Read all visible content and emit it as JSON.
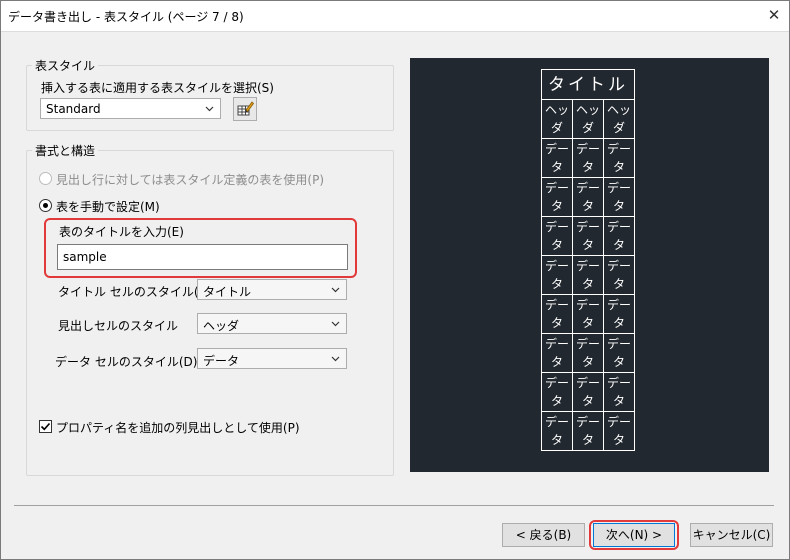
{
  "window": {
    "title": "データ書き出し - 表スタイル (ページ 7 / 8)",
    "close_glyph": "✕"
  },
  "table_style": {
    "group_label": "表スタイル",
    "select_label": "挿入する表に適用する表スタイルを選択(S)",
    "selected": "Standard"
  },
  "format": {
    "group_label": "書式と構造",
    "radio_style_label": "見出し行に対しては表スタイル定義の表を使用(P)",
    "radio_manual_label": "表を手動で設定(M)",
    "title_input_label": "表のタイトルを入力(E)",
    "title_input_value": "sample",
    "title_cell_label": "タイトル セルのスタイル(T)",
    "title_cell_value": "タイトル",
    "header_cell_label": "見出しセルのスタイル",
    "header_cell_value": "ヘッダ",
    "data_cell_label": "データ セルのスタイル(D)",
    "data_cell_value": "データ",
    "property_checkbox_label": "プロパティ名を追加の列見出しとして使用(P)"
  },
  "preview": {
    "title": "タイトル",
    "header_cell": "ヘッダ",
    "data_cell": "データ",
    "header_lines": [
      "ヘッ",
      "ダ"
    ],
    "data_lines": [
      "デー",
      "タ"
    ],
    "data_row_count": 8
  },
  "buttons": {
    "back": "< 戻る(B)",
    "next": "次へ(N) >",
    "cancel": "キャンセル(C)"
  },
  "colors": {
    "highlight": "#e23a3a",
    "preview_bg": "#22282f",
    "accent": "#0078d7"
  },
  "icons": {
    "close": "close-icon",
    "edit": "table-style-edit-icon",
    "dropdown": "chevron-down-icon"
  }
}
